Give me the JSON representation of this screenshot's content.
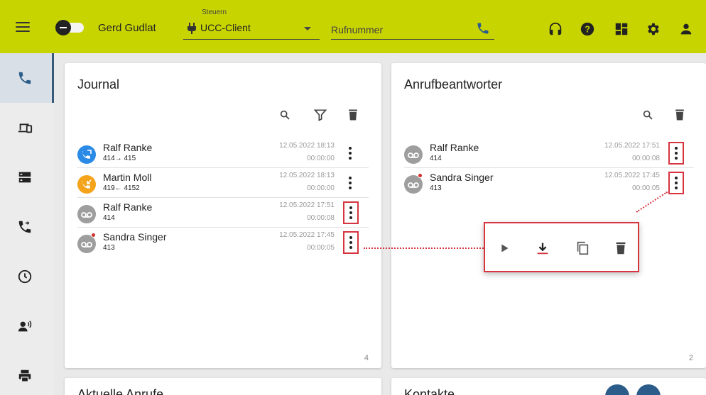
{
  "colors": {
    "brand": "#c8d400",
    "highlight": "#d6343f",
    "outgoing": "#2b8ae6",
    "incoming": "#f5a31a",
    "voicemail": "#9e9e9e",
    "missed_dot": "#d32f2f"
  },
  "topbar": {
    "menu_icon": "hamburger-icon",
    "user_name": "Gerd Gudlat",
    "control_label": "Steuern",
    "client_value": "UCC-Client",
    "number_placeholder": "Rufnummer",
    "icons": [
      "headset-icon",
      "help-icon",
      "dashboard-icon",
      "settings-icon",
      "user-icon"
    ]
  },
  "sidebar": {
    "items": [
      "phone-icon",
      "devices-icon",
      "server-icon",
      "call-forward-icon",
      "history-icon",
      "voice-icon",
      "printer-icon"
    ],
    "active_index": 0
  },
  "journal": {
    "title": "Journal",
    "tools": [
      "search-icon",
      "filter-icon",
      "delete-icon"
    ],
    "rows": [
      {
        "type": "outgoing",
        "name": "Ralf Ranke",
        "sub": "414→ 415",
        "date": "12.05.2022 18:13",
        "duration": "00:00:00",
        "dot": false,
        "highlight": false
      },
      {
        "type": "incoming",
        "name": "Martin Moll",
        "sub": "419← 4152",
        "date": "12.05.2022 18:13",
        "duration": "00:00:00",
        "dot": false,
        "highlight": false
      },
      {
        "type": "voicemail",
        "name": "Ralf Ranke",
        "sub": "414",
        "date": "12.05.2022 17:51",
        "duration": "00:00:08",
        "dot": false,
        "highlight": true
      },
      {
        "type": "voicemail",
        "name": "Sandra Singer",
        "sub": "413",
        "date": "12.05.2022 17:45",
        "duration": "00:00:05",
        "dot": true,
        "highlight": true
      }
    ],
    "count": "4"
  },
  "answering_machine": {
    "title": "Anrufbeantworter",
    "tools": [
      "search-icon",
      "delete-icon"
    ],
    "rows": [
      {
        "type": "voicemail",
        "name": "Ralf Ranke",
        "sub": "414",
        "date": "12.05.2022 17:51",
        "duration": "00:00:08",
        "dot": false,
        "highlight": true
      },
      {
        "type": "voicemail",
        "name": "Sandra Singer",
        "sub": "413",
        "date": "12.05.2022 17:45",
        "duration": "00:00:05",
        "dot": true,
        "highlight": true
      }
    ],
    "count": "2"
  },
  "popup": {
    "actions": [
      "play-icon",
      "download-icon",
      "copy-icon",
      "delete-icon"
    ]
  },
  "bottom": {
    "left_title": "Aktuelle Anrufe",
    "right_title": "Kontakte"
  }
}
